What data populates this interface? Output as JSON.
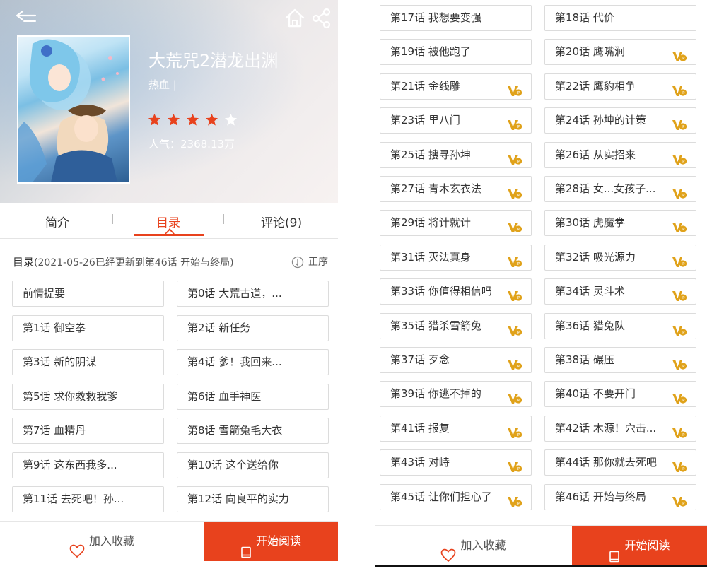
{
  "book": {
    "title": "大荒咒2潜龙出渊",
    "genre": "热血 |",
    "rating": 4,
    "rating_max": 5,
    "popularity": "人气：2368.13万"
  },
  "tabs": [
    {
      "label": "简介"
    },
    {
      "label": "目录"
    },
    {
      "label": "评论(9)"
    }
  ],
  "catalog": {
    "label": "目录",
    "update_note": "(2021-05-26已经更新到第46话 开始与终局)",
    "sort_label": "正序"
  },
  "left_chapters": [
    {
      "title": "前情提要",
      "vip": false
    },
    {
      "title": "第0话 大荒古道，...",
      "vip": false
    },
    {
      "title": "第1话 御空拳",
      "vip": false
    },
    {
      "title": "第2话 新任务",
      "vip": false
    },
    {
      "title": "第3话 新的阴谋",
      "vip": false
    },
    {
      "title": "第4话 爹！我回来...",
      "vip": false
    },
    {
      "title": "第5话 求你救救我爹",
      "vip": false
    },
    {
      "title": "第6话 血手神医",
      "vip": false
    },
    {
      "title": "第7话 血精丹",
      "vip": false
    },
    {
      "title": "第8话 雪箭兔毛大衣",
      "vip": false
    },
    {
      "title": "第9话 这东西我多...",
      "vip": false
    },
    {
      "title": "第10话 这个送给你",
      "vip": false
    },
    {
      "title": "第11话 去死吧！孙...",
      "vip": false
    },
    {
      "title": "第12话 向良平的实力",
      "vip": false
    }
  ],
  "right_chapters": [
    {
      "title": "第17话 我想要变强",
      "vip": false
    },
    {
      "title": "第18话 代价",
      "vip": false
    },
    {
      "title": "第19话 被他跑了",
      "vip": false
    },
    {
      "title": "第20话 鹰嘴涧",
      "vip": true
    },
    {
      "title": "第21话 金线雕",
      "vip": true
    },
    {
      "title": "第22话 鹰豹相争",
      "vip": true
    },
    {
      "title": "第23话 里八门",
      "vip": true
    },
    {
      "title": "第24话 孙坤的计策",
      "vip": true
    },
    {
      "title": "第25话 搜寻孙坤",
      "vip": true
    },
    {
      "title": "第26话 从实招来",
      "vip": true
    },
    {
      "title": "第27话 青木玄衣法",
      "vip": true
    },
    {
      "title": "第28话 女...女孩子...",
      "vip": true
    },
    {
      "title": "第29话 将计就计",
      "vip": true
    },
    {
      "title": "第30话 虎魔拳",
      "vip": true
    },
    {
      "title": "第31话 灭法真身",
      "vip": true
    },
    {
      "title": "第32话 吸光源力",
      "vip": true
    },
    {
      "title": "第33话 你值得相信吗",
      "vip": true
    },
    {
      "title": "第34话 灵斗术",
      "vip": true
    },
    {
      "title": "第35话 猎杀雪箭兔",
      "vip": true
    },
    {
      "title": "第36话 猎兔队",
      "vip": true
    },
    {
      "title": "第37话 歹念",
      "vip": true
    },
    {
      "title": "第38话 碾压",
      "vip": true
    },
    {
      "title": "第39话 你逃不掉的",
      "vip": true
    },
    {
      "title": "第40话 不要开门",
      "vip": true
    },
    {
      "title": "第41话 报复",
      "vip": true
    },
    {
      "title": "第42话 木源！穴击...",
      "vip": true
    },
    {
      "title": "第43话 对峙",
      "vip": true
    },
    {
      "title": "第44话 那你就去死吧",
      "vip": true
    },
    {
      "title": "第45话 让你们担心了",
      "vip": true
    },
    {
      "title": "第46话 开始与终局",
      "vip": true
    }
  ],
  "bottom": {
    "favorite_label": "加入收藏",
    "read_label": "开始阅读"
  },
  "colors": {
    "accent": "#e8421d",
    "vip_gold": "#e0a21a",
    "star": "#e8421d"
  },
  "icons": {
    "back": "back-arrow-icon",
    "home": "home-icon",
    "share": "share-icon",
    "sort": "sort-icon",
    "vip": "vip-badge-icon",
    "favorite": "heart-icon",
    "read": "book-icon"
  }
}
